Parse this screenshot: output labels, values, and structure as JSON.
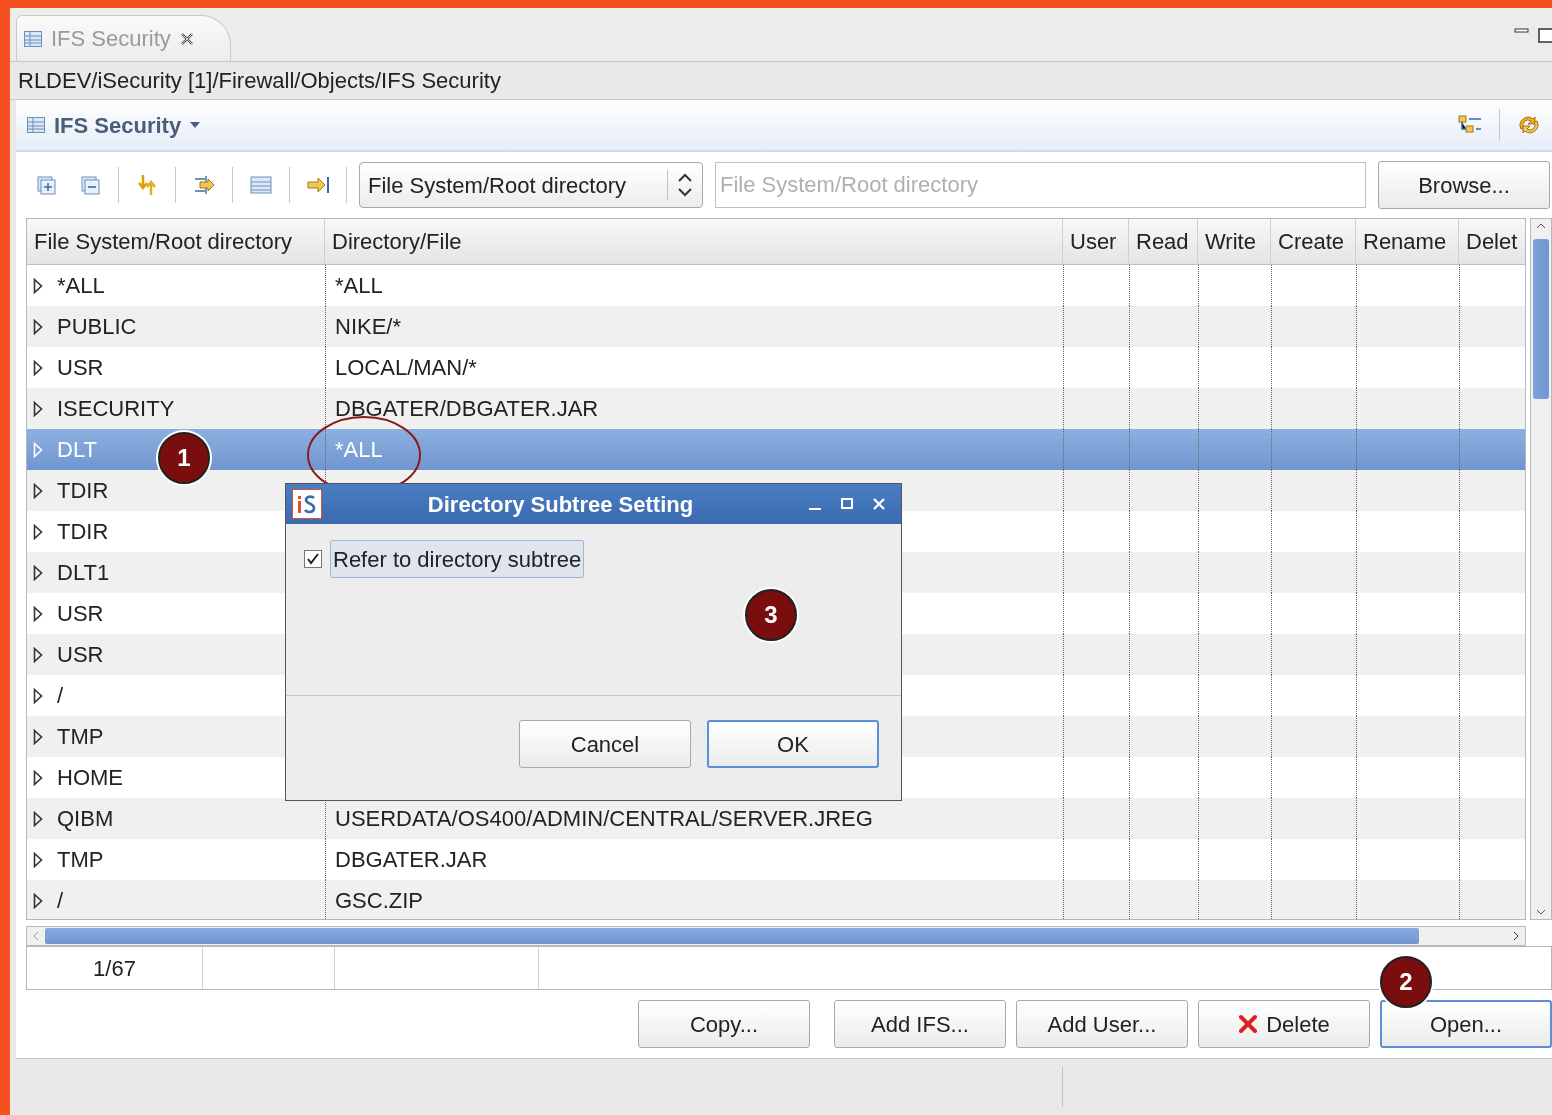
{
  "tab": {
    "title": "IFS Security"
  },
  "breadcrumb": "RLDEV/iSecurity [1]/Firewall/Objects/IFS Security",
  "view": {
    "title": "IFS Security"
  },
  "toolbar": {
    "dropdown": "File System/Root directory",
    "path_field": {
      "placeholder": "File System/Root directory"
    },
    "browse_button": "Browse..."
  },
  "table": {
    "columns": [
      "File System/Root directory",
      "Directory/File",
      "User",
      "Read",
      "Write",
      "Create",
      "Rename",
      "Delet"
    ],
    "rows": [
      {
        "root": "*ALL",
        "path": "*ALL",
        "selected": false
      },
      {
        "root": "PUBLIC",
        "path": "NIKE/*",
        "selected": false
      },
      {
        "root": "USR",
        "path": "LOCAL/MAN/*",
        "selected": false
      },
      {
        "root": "ISECURITY",
        "path": "DBGATER/DBGATER.JAR",
        "selected": false
      },
      {
        "root": "DLT",
        "path": "*ALL",
        "selected": true
      },
      {
        "root": "TDIR",
        "selected": false
      },
      {
        "root": "TDIR",
        "selected": false
      },
      {
        "root": "DLT1",
        "selected": false
      },
      {
        "root": "USR",
        "selected": false
      },
      {
        "root": "USR",
        "selected": false
      },
      {
        "root": "/",
        "selected": false
      },
      {
        "root": "TMP",
        "selected": false
      },
      {
        "root": "HOME",
        "selected": false
      },
      {
        "root": "QIBM",
        "path": "USERDATA/OS400/ADMIN/CENTRAL/SERVER.JREG",
        "selected": false
      },
      {
        "root": "TMP",
        "path": "DBGATER.JAR",
        "selected": false
      },
      {
        "root": "/",
        "path": "GSC.ZIP",
        "selected": false
      }
    ]
  },
  "status_cells": [
    "1/67"
  ],
  "buttons": [
    {
      "label": "Copy...",
      "kind": "plain",
      "focused": false
    },
    {
      "label": "Add IFS...",
      "kind": "plain",
      "focused": false
    },
    {
      "label": "Add User...",
      "kind": "plain",
      "focused": false
    },
    {
      "label": "Delete",
      "kind": "delete",
      "focused": false
    },
    {
      "label": "Open...",
      "kind": "plain",
      "focused": true
    }
  ],
  "dialog": {
    "title": "Directory Subtree Setting",
    "checkbox": {
      "label": "Refer to directory subtree",
      "checked": true
    },
    "buttons": [
      {
        "label": "Cancel",
        "focused": false
      },
      {
        "label": "OK",
        "focused": true
      }
    ]
  },
  "annotations": [
    {
      "label": "1"
    },
    {
      "label": "2"
    },
    {
      "label": "3"
    }
  ]
}
